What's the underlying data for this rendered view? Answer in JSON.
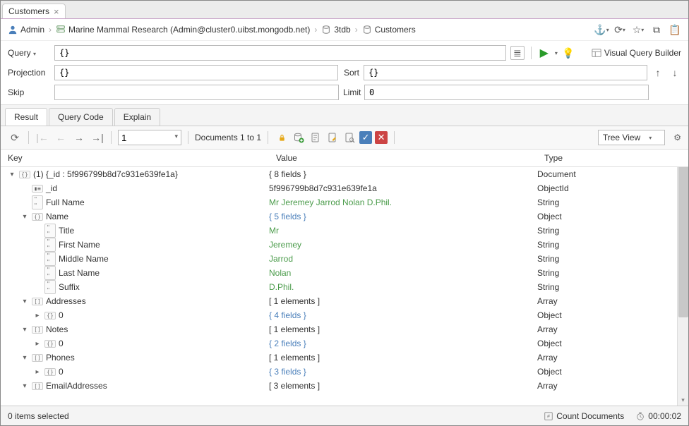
{
  "tab": {
    "title": "Customers"
  },
  "breadcrumb": {
    "user": "Admin",
    "connection": "Marine Mammal Research (Admin@cluster0.uibst.mongodb.net)",
    "database": "3tdb",
    "collection": "Customers"
  },
  "query": {
    "label": "Query",
    "value": "{}",
    "projection_label": "Projection",
    "projection_value": "{}",
    "sort_label": "Sort",
    "sort_value": "{}",
    "skip_label": "Skip",
    "skip_value": "",
    "limit_label": "Limit",
    "limit_value": "0",
    "vqb_label": "Visual Query Builder"
  },
  "subtabs": {
    "result": "Result",
    "query_code": "Query Code",
    "explain": "Explain"
  },
  "nav": {
    "page": "1",
    "doc_label": "Documents 1 to 1",
    "view": "Tree View"
  },
  "columns": {
    "key": "Key",
    "value": "Value",
    "type": "Type"
  },
  "tree": [
    {
      "indent": 0,
      "caret": "down",
      "icon": "obj",
      "key": "(1) {_id : 5f996799b8d7c931e639fe1a}",
      "value": "{ 8 fields }",
      "vclass": "",
      "type": "Document"
    },
    {
      "indent": 1,
      "caret": "",
      "icon": "id",
      "key": "_id",
      "value": "5f996799b8d7c931e639fe1a",
      "vclass": "",
      "type": "ObjectId"
    },
    {
      "indent": 1,
      "caret": "",
      "icon": "str",
      "key": "Full Name",
      "value": "Mr Jeremey Jarrod Nolan D.Phil.",
      "vclass": "val-str",
      "type": "String"
    },
    {
      "indent": 1,
      "caret": "down",
      "icon": "obj",
      "key": "Name",
      "value": "{ 5 fields }",
      "vclass": "val-obj",
      "type": "Object"
    },
    {
      "indent": 2,
      "caret": "",
      "icon": "str",
      "key": "Title",
      "value": "Mr",
      "vclass": "val-str",
      "type": "String"
    },
    {
      "indent": 2,
      "caret": "",
      "icon": "str",
      "key": "First Name",
      "value": "Jeremey",
      "vclass": "val-str",
      "type": "String"
    },
    {
      "indent": 2,
      "caret": "",
      "icon": "str",
      "key": "Middle Name",
      "value": "Jarrod",
      "vclass": "val-str",
      "type": "String"
    },
    {
      "indent": 2,
      "caret": "",
      "icon": "str",
      "key": "Last Name",
      "value": "Nolan",
      "vclass": "val-str",
      "type": "String"
    },
    {
      "indent": 2,
      "caret": "",
      "icon": "str",
      "key": "Suffix",
      "value": "D.Phil.",
      "vclass": "val-str",
      "type": "String"
    },
    {
      "indent": 1,
      "caret": "down",
      "icon": "arr",
      "key": "Addresses",
      "value": "[ 1 elements ]",
      "vclass": "",
      "type": "Array"
    },
    {
      "indent": 2,
      "caret": "right",
      "icon": "obj",
      "key": "0",
      "value": "{ 4 fields }",
      "vclass": "val-obj",
      "type": "Object"
    },
    {
      "indent": 1,
      "caret": "down",
      "icon": "arr",
      "key": "Notes",
      "value": "[ 1 elements ]",
      "vclass": "",
      "type": "Array"
    },
    {
      "indent": 2,
      "caret": "right",
      "icon": "obj",
      "key": "0",
      "value": "{ 2 fields }",
      "vclass": "val-obj",
      "type": "Object"
    },
    {
      "indent": 1,
      "caret": "down",
      "icon": "arr",
      "key": "Phones",
      "value": "[ 1 elements ]",
      "vclass": "",
      "type": "Array"
    },
    {
      "indent": 2,
      "caret": "right",
      "icon": "obj",
      "key": "0",
      "value": "{ 3 fields }",
      "vclass": "val-obj",
      "type": "Object"
    },
    {
      "indent": 1,
      "caret": "down",
      "icon": "arr",
      "key": "EmailAddresses",
      "value": "[ 3 elements ]",
      "vclass": "",
      "type": "Array"
    }
  ],
  "status": {
    "selected": "0 items selected",
    "count": "Count Documents",
    "time": "00:00:02"
  }
}
